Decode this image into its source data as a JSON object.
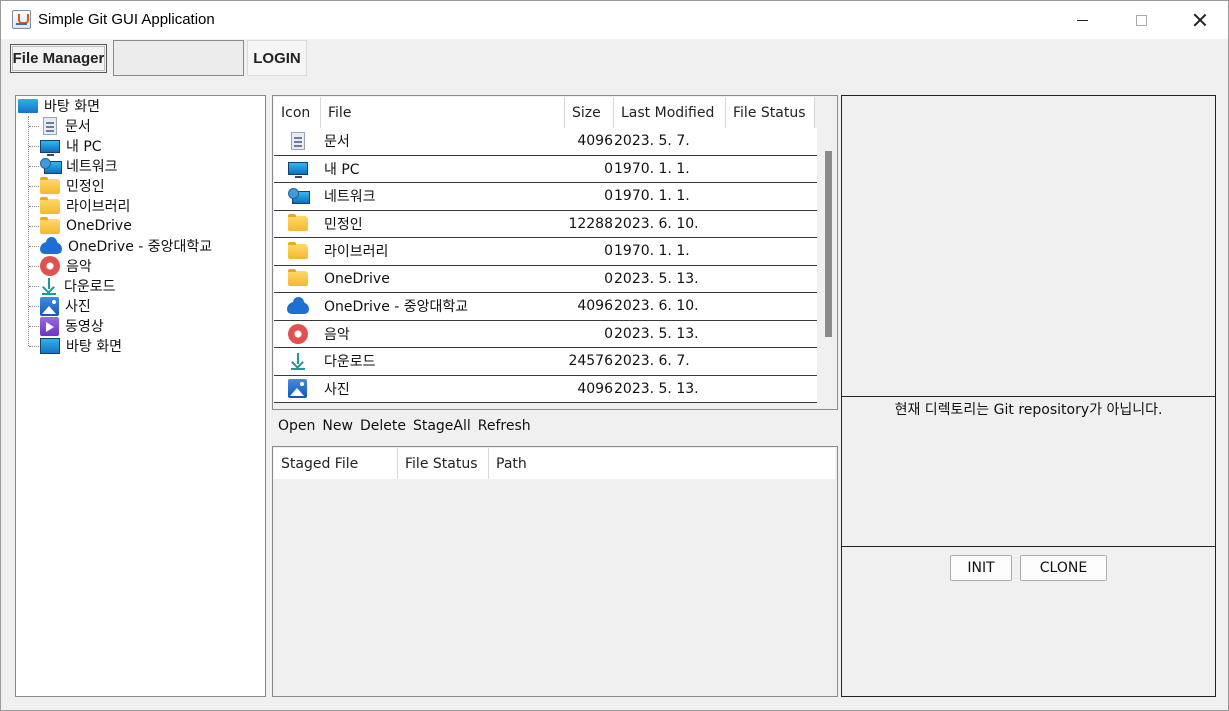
{
  "window": {
    "title": "Simple Git GUI Application"
  },
  "toolbar": {
    "file_manager_label": "File Manager",
    "user_field_value": "",
    "login_label": "LOGIN"
  },
  "tree": {
    "root": {
      "label": "바탕 화면",
      "icon": "desktop-icon"
    },
    "items": [
      {
        "label": "문서",
        "icon": "document-icon"
      },
      {
        "label": "내 PC",
        "icon": "pc-icon"
      },
      {
        "label": "네트워크",
        "icon": "network-icon"
      },
      {
        "label": "민정인",
        "icon": "folder-icon"
      },
      {
        "label": "라이브러리",
        "icon": "folder-icon"
      },
      {
        "label": "OneDrive",
        "icon": "folder-icon"
      },
      {
        "label": "OneDrive - 중앙대학교",
        "icon": "cloud-icon"
      },
      {
        "label": "음악",
        "icon": "music-icon"
      },
      {
        "label": "다운로드",
        "icon": "download-icon"
      },
      {
        "label": "사진",
        "icon": "photo-icon"
      },
      {
        "label": "동영상",
        "icon": "video-icon"
      },
      {
        "label": "바탕 화면",
        "icon": "desktop-icon"
      }
    ]
  },
  "file_table": {
    "columns": [
      "Icon",
      "File",
      "Size",
      "Last Modified",
      "File Status"
    ],
    "rows": [
      {
        "icon": "document-icon",
        "file": "문서",
        "size": "4096",
        "modified": "2023. 5. 7.",
        "status": ""
      },
      {
        "icon": "pc-icon",
        "file": "내 PC",
        "size": "0",
        "modified": "1970. 1. 1.",
        "status": ""
      },
      {
        "icon": "network-icon",
        "file": "네트워크",
        "size": "0",
        "modified": "1970. 1. 1.",
        "status": ""
      },
      {
        "icon": "folder-icon",
        "file": "민정인",
        "size": "12288",
        "modified": "2023. 6. 10.",
        "status": ""
      },
      {
        "icon": "folder-icon",
        "file": "라이브러리",
        "size": "0",
        "modified": "1970. 1. 1.",
        "status": ""
      },
      {
        "icon": "folder-icon",
        "file": "OneDrive",
        "size": "0",
        "modified": "2023. 5. 13.",
        "status": ""
      },
      {
        "icon": "cloud-icon",
        "file": "OneDrive - 중앙대학교",
        "size": "4096",
        "modified": "2023. 6. 10.",
        "status": ""
      },
      {
        "icon": "music-icon",
        "file": "음악",
        "size": "0",
        "modified": "2023. 5. 13.",
        "status": ""
      },
      {
        "icon": "download-icon",
        "file": "다운로드",
        "size": "24576",
        "modified": "2023. 6. 7.",
        "status": ""
      },
      {
        "icon": "photo-icon",
        "file": "사진",
        "size": "4096",
        "modified": "2023. 5. 13.",
        "status": ""
      }
    ]
  },
  "actions": [
    "Open",
    "New",
    "Delete",
    "StageAll",
    "Refresh"
  ],
  "staged_table": {
    "columns": [
      "Staged File",
      "File Status",
      "Path"
    ]
  },
  "git_panel": {
    "message": "현재 디렉토리는 Git repository가 아닙니다.",
    "init_label": "INIT",
    "clone_label": "CLONE"
  }
}
